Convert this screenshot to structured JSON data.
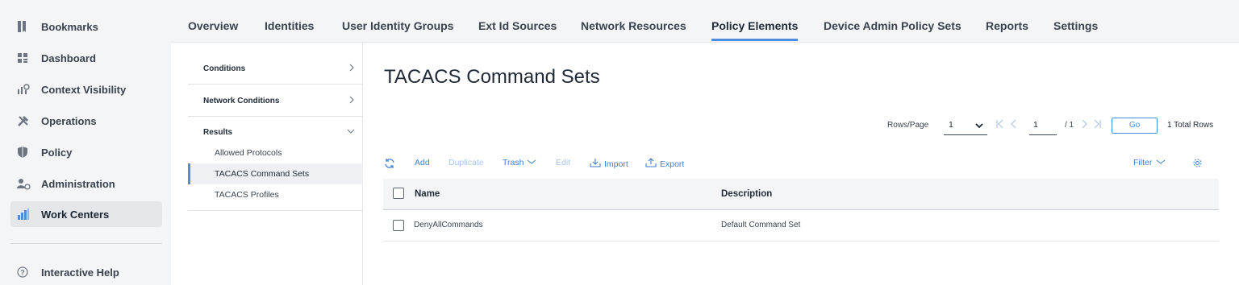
{
  "leftnav": {
    "items": [
      {
        "label": "Bookmarks",
        "icon": "bookmark-icon"
      },
      {
        "label": "Dashboard",
        "icon": "dashboard-icon"
      },
      {
        "label": "Context Visibility",
        "icon": "context-visibility-icon"
      },
      {
        "label": "Operations",
        "icon": "operations-icon"
      },
      {
        "label": "Policy",
        "icon": "policy-icon"
      },
      {
        "label": "Administration",
        "icon": "administration-icon"
      },
      {
        "label": "Work Centers",
        "icon": "work-centers-icon",
        "active": true
      }
    ],
    "help": {
      "label": "Interactive Help",
      "icon": "help-icon"
    }
  },
  "tabs": [
    {
      "label": "Overview"
    },
    {
      "label": "Identities"
    },
    {
      "label": "User Identity Groups"
    },
    {
      "label": "Ext Id Sources"
    },
    {
      "label": "Network Resources"
    },
    {
      "label": "Policy Elements",
      "active": true
    },
    {
      "label": "Device Admin Policy Sets"
    },
    {
      "label": "Reports"
    },
    {
      "label": "Settings"
    }
  ],
  "subnav": {
    "conditions": "Conditions",
    "network_conditions": "Network Conditions",
    "results": "Results",
    "result_items": [
      "Allowed Protocols",
      "TACACS Command Sets",
      "TACACS Profiles"
    ]
  },
  "main": {
    "title": "TACACS Command Sets",
    "pager": {
      "rows_label": "Rows/Page",
      "rows_value": "1",
      "page_value": "1",
      "page_of": "/ 1",
      "go": "Go",
      "total": "1 Total Rows"
    },
    "toolbar": {
      "add": "Add",
      "duplicate": "Duplicate",
      "trash": "Trash",
      "edit": "Edit",
      "import": "Import",
      "export": "Export",
      "filter": "Filter"
    },
    "table": {
      "columns": [
        "Name",
        "Description"
      ],
      "rows": [
        {
          "name": "DenyAllCommands",
          "description": "Default Command Set"
        }
      ]
    }
  },
  "colors": {
    "accent": "#4b8ddf",
    "link": "#3f7fd3",
    "disabled": "#a9c5ea"
  }
}
